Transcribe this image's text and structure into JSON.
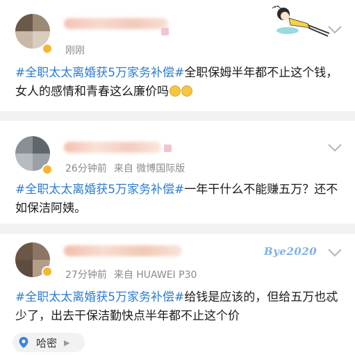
{
  "colors": {
    "topic": "#2c7cd0",
    "meta": "#8a8a8a",
    "text": "#1a1a1a",
    "verified_badge": "#f5b731",
    "background": "#f2f2f2"
  },
  "posts": [
    {
      "time": "刚刚",
      "source": "",
      "topic": "#全职太太离婚获5万家务补偿#",
      "text": "全职保姆半年都不止这个钱，女人的感情和青春这么廉价吗",
      "icons": [
        "avatar",
        "verified-badge",
        "chevron-down-icon",
        "crying-laughing-emoji-icon",
        "lying-girl-sticker"
      ]
    },
    {
      "time": "26分钟前",
      "source": "来自 微博国际版",
      "topic": "#全职太太离婚获5万家务补偿#",
      "text": "一年干什么不能赚五万？还不如保洁阿姨。",
      "icons": [
        "avatar",
        "verified-badge",
        "chevron-down-icon"
      ]
    },
    {
      "time": "27分钟前",
      "source": "来自 HUAWEI P30",
      "topic": "#全职太太离婚获5万家务补偿#",
      "text": "给钱是应该的，但给五万也忒少了，出去干保洁勤快点半年都不止这个价",
      "sticker_text": "Bye2020",
      "location": "哈密",
      "icons": [
        "avatar",
        "verified-badge",
        "chevron-down-icon",
        "location-pin-icon",
        "chevron-right-icon"
      ]
    }
  ]
}
